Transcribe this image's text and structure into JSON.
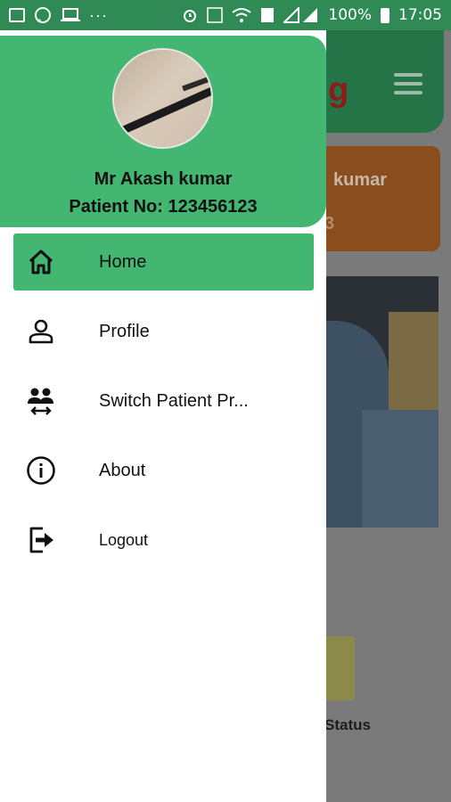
{
  "status_bar": {
    "battery": "100%",
    "time": "17:05",
    "more": "···"
  },
  "background_app": {
    "title_fragment": "g",
    "card_name_fragment": "kumar",
    "card_number_fragment": "3",
    "status_label": "Status"
  },
  "drawer": {
    "user_name": "Mr Akash kumar",
    "patient_no": "Patient No: 123456123",
    "items": [
      {
        "label": "Home",
        "icon": "home-icon",
        "active": true
      },
      {
        "label": "Profile",
        "icon": "person-icon",
        "active": false
      },
      {
        "label": "Switch Patient Pr...",
        "icon": "switch-patient-icon",
        "active": false
      },
      {
        "label": "About",
        "icon": "info-icon",
        "active": false
      },
      {
        "label": "Logout",
        "icon": "logout-icon",
        "active": false
      }
    ]
  },
  "colors": {
    "drawer_accent": "#43b672",
    "status_bar": "#2f8a55"
  }
}
